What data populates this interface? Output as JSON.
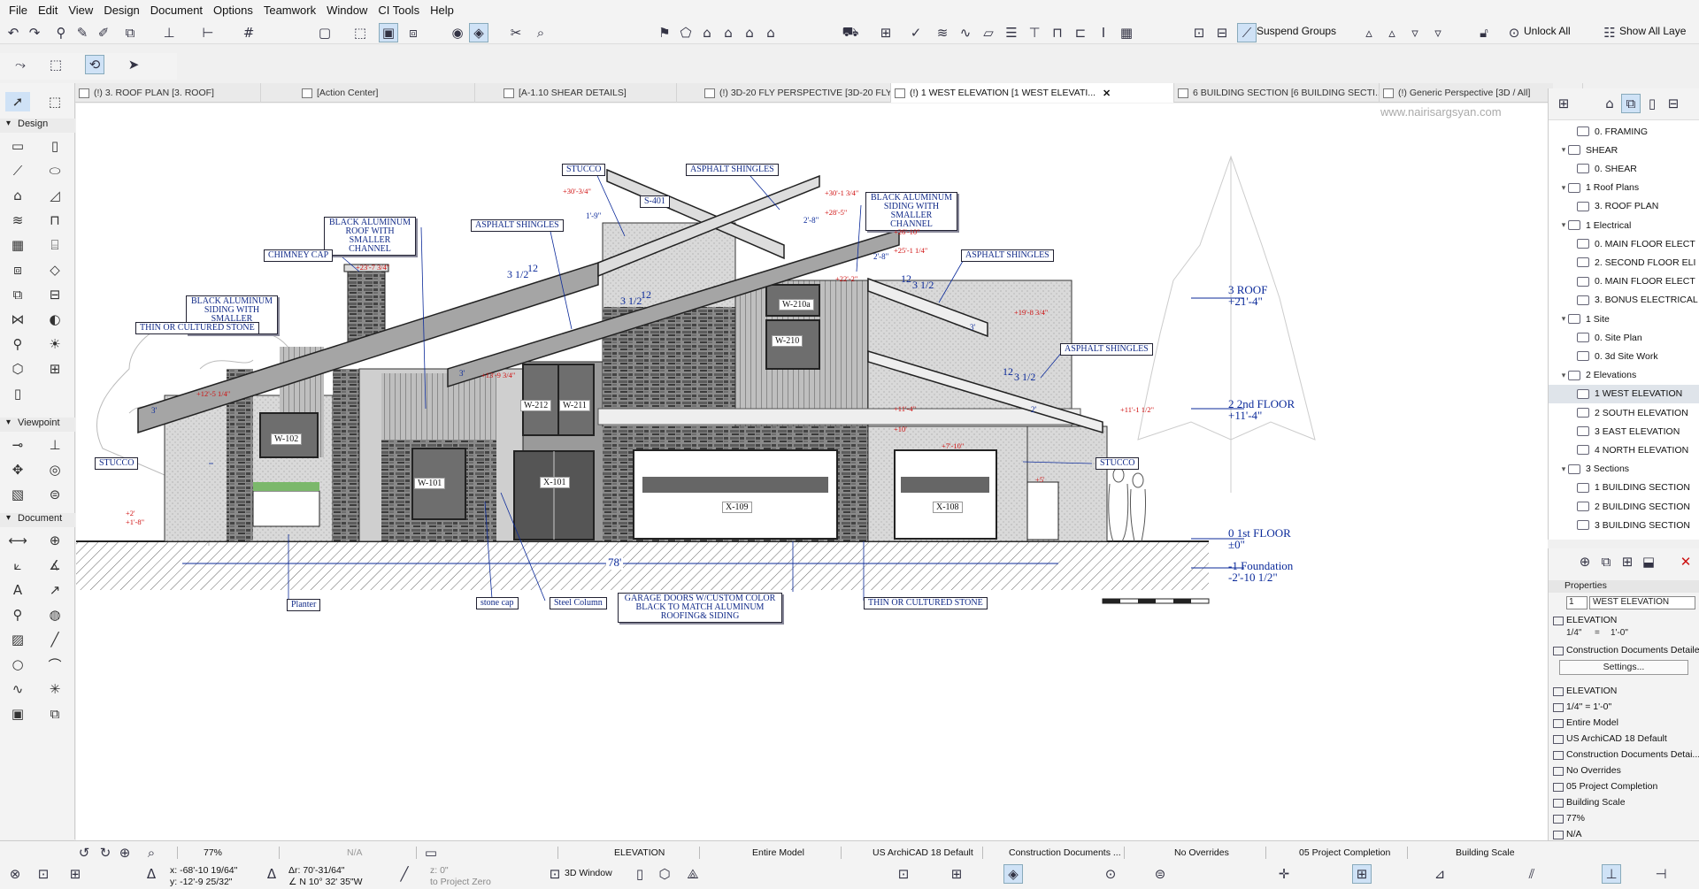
{
  "menu": [
    "File",
    "Edit",
    "View",
    "Design",
    "Document",
    "Options",
    "Teamwork",
    "Window",
    "CI Tools",
    "Help"
  ],
  "toolbar": {
    "suspend_groups": "Suspend Groups",
    "unlock_all": "Unlock All",
    "show_all_layers": "Show All Laye"
  },
  "tabs": [
    {
      "label": "(!) 3. ROOF PLAN [3. ROOF]",
      "active": false
    },
    {
      "label": "[Action Center]",
      "active": false
    },
    {
      "label": "[A-1.10 SHEAR DETAILS]",
      "active": false
    },
    {
      "label": "(!) 3D-20 FLY PERSPECTIVE [3D-20 FLY PE...",
      "active": false
    },
    {
      "label": "(!) 1 WEST ELEVATION [1 WEST ELEVATI...",
      "active": true
    },
    {
      "label": "6 BUILDING SECTION [6 BUILDING SECTI...",
      "active": false
    },
    {
      "label": "(!) Generic Perspective [3D / All]",
      "active": false
    }
  ],
  "toolbox": {
    "sections": [
      "Design",
      "Viewpoint",
      "Document"
    ]
  },
  "watermark": "www.nairisargsyan.com",
  "drawing": {
    "labels": {
      "stucco_top": "STUCCO",
      "asphalt_top": "ASPHALT SHINGLES",
      "s401": "S-401",
      "black_alu_siding_right": "BLACK ALUMINUM SIDING WITH SMALLER CHANNEL",
      "black_alu_roof": "BLACK ALUMINUM ROOF WITH SMALLER CHANNEL",
      "asphalt_mid": "ASPHALT SHINGLES",
      "chimney_cap": "CHIMNEY CAP",
      "black_alu_siding_left": "BLACK ALUMINUM SIDING WITH SMALLER CHANNEL",
      "thin_stone_left": "THIN OR CULTURED STONE",
      "asphalt_right": "ASPHALT SHINGLES",
      "asphalt_far_right": "ASPHALT SHINGLES",
      "stucco_left": "STUCCO",
      "stucco_right": "STUCCO",
      "planter": "Planter",
      "stone_cap": "stone cap",
      "steel_column": "Steel Column",
      "garage_doors": "GARAGE DOORS W/CUSTOM COLOR BLACK TO MATCH ALUMINUM ROOFING& SIDING",
      "thin_stone_bottom": "THIN OR CULTURED STONE",
      "overall_dim": "78'"
    },
    "windows": [
      "W-102",
      "W-101",
      "W-212",
      "W-211",
      "X-101",
      "X-109",
      "X-108",
      "W-210a",
      "W-210"
    ],
    "levels": [
      {
        "name": "3 ROOF",
        "value": "+21'-4\""
      },
      {
        "name": "2 2nd FLOOR",
        "value": "+11'-4\""
      },
      {
        "name": "0 1st FLOOR",
        "value": "±0\""
      },
      {
        "name": "-1 Foundation",
        "value": "-2'-10 1/2\""
      }
    ],
    "elevations": [
      "+30'-3/4\"",
      "+30'-1 3/4\"",
      "+28'-5\"",
      "+26'-10\"",
      "+25'-1 1/4\"",
      "+23'-7 3/4\"",
      "+22'-2\"",
      "+19'-8 3/4\"",
      "+13'-9 3/4\"",
      "+12'-5 1/4\"",
      "+11'-1 1/2\"",
      "+11'-4\"",
      "+10'",
      "+7'-10\"",
      "+5'",
      "+2'",
      "+1'-8\""
    ],
    "slopes": [
      "3 1/2",
      "12",
      "3 1/2",
      "12",
      "3 1/2",
      "12",
      "3 1/2",
      "12"
    ],
    "dims": [
      "1'-9\"",
      "2'-8\"",
      "2'-8\"",
      "3'",
      "3'",
      "3'",
      "2'"
    ]
  },
  "navigator": {
    "items": [
      {
        "label": "0. FRAMING",
        "level": 2,
        "folder": false,
        "selected": false
      },
      {
        "label": "SHEAR",
        "level": 1,
        "folder": true,
        "selected": false
      },
      {
        "label": "0. SHEAR",
        "level": 2,
        "folder": false,
        "selected": false
      },
      {
        "label": "1 Roof Plans",
        "level": 1,
        "folder": true,
        "selected": false
      },
      {
        "label": "3. ROOF PLAN",
        "level": 2,
        "folder": false,
        "selected": false
      },
      {
        "label": "1 Electrical",
        "level": 1,
        "folder": true,
        "selected": false
      },
      {
        "label": "0. MAIN FLOOR ELECT",
        "level": 2,
        "folder": false,
        "selected": false
      },
      {
        "label": "2. SECOND FLOOR ELI",
        "level": 2,
        "folder": false,
        "selected": false
      },
      {
        "label": "0. MAIN FLOOR ELECT",
        "level": 2,
        "folder": false,
        "selected": false
      },
      {
        "label": "3. BONUS ELECTRICAL",
        "level": 2,
        "folder": false,
        "selected": false
      },
      {
        "label": "1 Site",
        "level": 1,
        "folder": true,
        "selected": false
      },
      {
        "label": "0. Site Plan",
        "level": 2,
        "folder": false,
        "selected": false
      },
      {
        "label": "0. 3d Site Work",
        "level": 2,
        "folder": false,
        "selected": false
      },
      {
        "label": "2 Elevations",
        "level": 1,
        "folder": true,
        "selected": false
      },
      {
        "label": "1 WEST ELEVATION",
        "level": 2,
        "folder": false,
        "selected": true
      },
      {
        "label": "2 SOUTH ELEVATION",
        "level": 2,
        "folder": false,
        "selected": false
      },
      {
        "label": "3 EAST ELEVATION",
        "level": 2,
        "folder": false,
        "selected": false
      },
      {
        "label": "4 NORTH ELEVATION",
        "level": 2,
        "folder": false,
        "selected": false
      },
      {
        "label": "3 Sections",
        "level": 1,
        "folder": true,
        "selected": false
      },
      {
        "label": "1 BUILDING SECTION",
        "level": 2,
        "folder": false,
        "selected": false
      },
      {
        "label": "2 BUILDING SECTION",
        "level": 2,
        "folder": false,
        "selected": false
      },
      {
        "label": "3 BUILDING SECTION",
        "level": 2,
        "folder": false,
        "selected": false
      }
    ]
  },
  "properties": {
    "header": "Properties",
    "id_value": "1",
    "name_value": "WEST ELEVATION",
    "type": "ELEVATION",
    "scale_left": "1/4\"",
    "scale_eq": "=",
    "scale_right": "1'-0\"",
    "view_set": "Construction Documents Detailed",
    "settings": "Settings...",
    "rows": [
      "ELEVATION",
      "1/4\"   =   1'-0\"",
      "Entire Model",
      "US ArchiCAD 18 Default",
      "Construction Documents Detai...",
      "No Overrides",
      "05 Project Completion",
      "Building Scale",
      "77%",
      "N/A"
    ]
  },
  "status": {
    "zoom": "77%",
    "na": "N/A",
    "view": "ELEVATION",
    "model": "Entire Model",
    "standard": "US ArchiCAD 18 Default",
    "doc": "Construction Documents ...",
    "overrides": "No Overrides",
    "renovation": "05 Project Completion",
    "scale": "Building Scale",
    "x_coord": "x: -68'-10 19/64\"",
    "y_coord": "y: -12'-9 25/32\"",
    "a_coord": "Δr: 70'-31/64\"",
    "angle": "∠ N 10° 32' 35\"W",
    "z_value": "z: 0\"",
    "to_project_zero": "to Project Zero",
    "window_3d": "3D Window"
  },
  "colors": {
    "accent": "#0b2a9a",
    "elev_red": "#d01010",
    "label_blue": "#112a88"
  }
}
